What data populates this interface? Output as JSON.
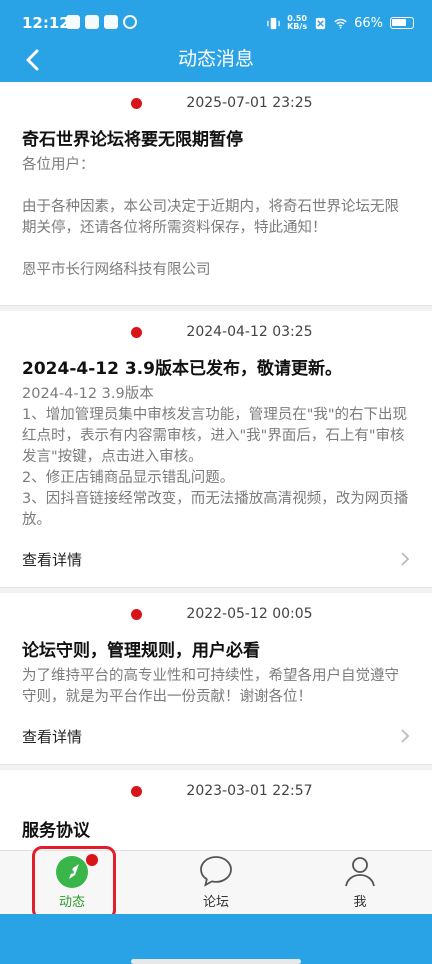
{
  "status_bar": {
    "time": "12:12",
    "net_speed_value": "0.50",
    "net_speed_unit": "KB/s",
    "battery": "66%",
    "accent_color": "#2aa3e6"
  },
  "header": {
    "back_icon": "chevron-left-icon",
    "title": "动态消息"
  },
  "posts": [
    {
      "unread": true,
      "date": "2025-07-01 23:25",
      "title": "奇石世界论坛将要无限期暂停",
      "body": "各位用户：\n\n由于各种因素，本公司决定于近期内，将奇石世界论坛无限期关停，还请各位将所需资料保存，特此通知！\n\n恩平市长行网络科技有限公司",
      "detail_label": ""
    },
    {
      "unread": true,
      "date": "2024-04-12 03:25",
      "title": "2024-4-12 3.9版本已发布，敬请更新。",
      "body": "2024-4-12 3.9版本\n1、增加管理员集中审核发言功能，管理员在\"我\"的右下出现红点时，表示有内容需审核，进入\"我\"界面后，石上有\"审核发言\"按键，点击进入审核。\n2、修正店铺商品显示错乱问题。\n3、因抖音链接经常改变，而无法播放高清视频，改为网页播放。",
      "detail_label": "查看详情"
    },
    {
      "unread": true,
      "date": "2022-05-12 00:05",
      "title": "论坛守则，管理规则，用户必看",
      "body": "为了维持平台的高专业性和可持续性，希望各用户自觉遵守守则，就是为平台作出一份贡献！谢谢各位！",
      "detail_label": "查看详情"
    },
    {
      "unread": true,
      "date": "2023-03-01 22:57",
      "title": "服务协议",
      "body": "",
      "detail_label": ""
    }
  ],
  "bottom_nav": [
    {
      "label": "动态",
      "icon": "compass-icon",
      "active": true,
      "badge": true
    },
    {
      "label": "论坛",
      "icon": "chat-bubble-icon",
      "active": false,
      "badge": false
    },
    {
      "label": "我",
      "icon": "user-icon",
      "active": false,
      "badge": false
    }
  ]
}
